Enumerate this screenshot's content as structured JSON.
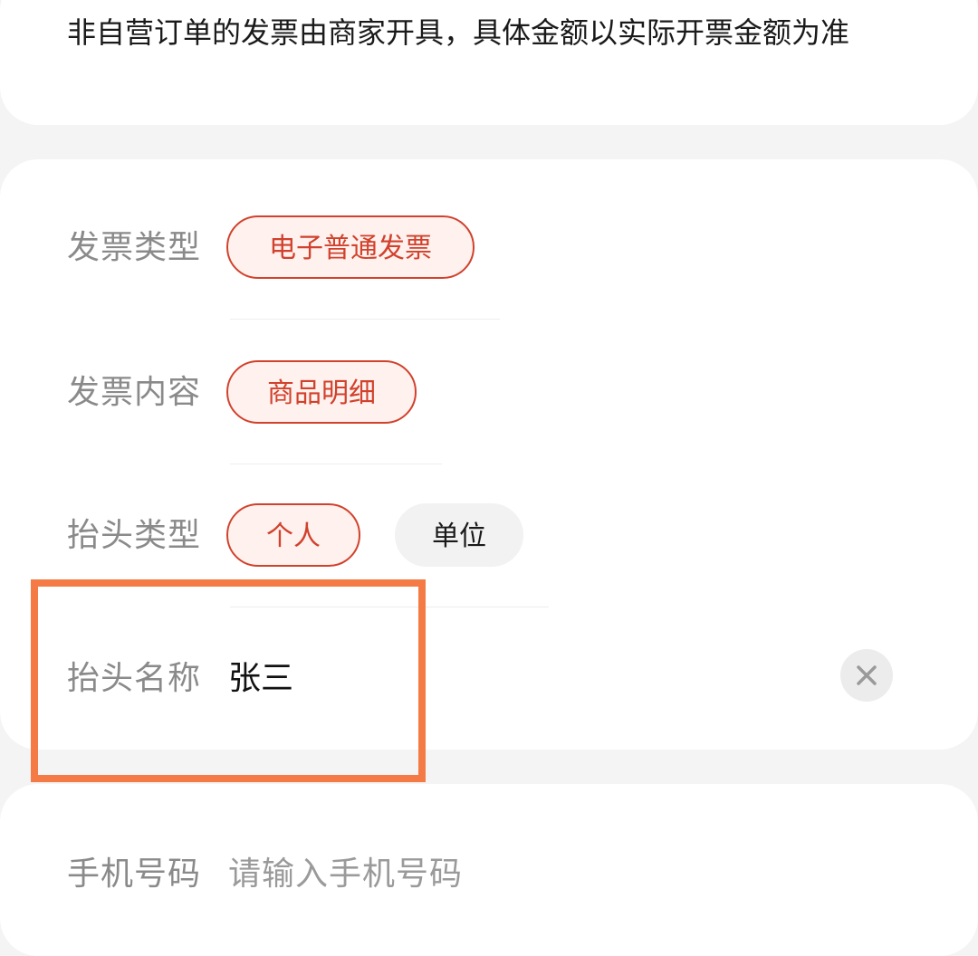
{
  "notice": {
    "text": "非自营订单的发票由商家开具，具体金额以实际开票金额为准"
  },
  "invoice_type": {
    "label": "发票类型",
    "selected": "电子普通发票"
  },
  "invoice_content": {
    "label": "发票内容",
    "selected": "商品明细"
  },
  "title_type": {
    "label": "抬头类型",
    "options": [
      {
        "label": "个人",
        "selected": true
      },
      {
        "label": "单位",
        "selected": false
      }
    ]
  },
  "title_name": {
    "label": "抬头名称",
    "value": "张三",
    "clear_icon": "close-icon"
  },
  "phone": {
    "label": "手机号码",
    "placeholder": "请输入手机号码"
  },
  "colors": {
    "accent": "#d1412c",
    "accent_bg": "#fff1ee",
    "highlight": "#f47b45",
    "page_bg": "#f4f4f4"
  }
}
